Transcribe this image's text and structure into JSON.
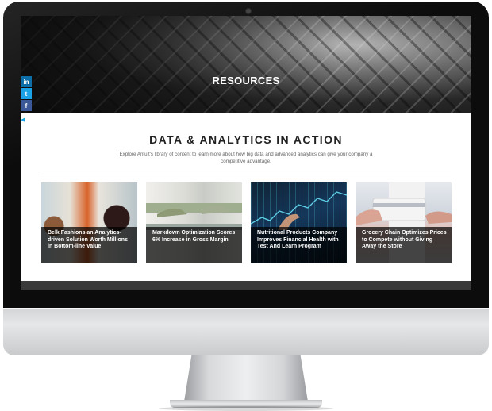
{
  "hero": {
    "title": "RESOURCES"
  },
  "social": [
    {
      "name": "linkedin-icon",
      "glyph": "in"
    },
    {
      "name": "twitter-icon",
      "glyph": "t"
    },
    {
      "name": "facebook-icon",
      "glyph": "f"
    }
  ],
  "section": {
    "title": "DATA & ANALYTICS IN ACTION",
    "description": "Explore Antuit's library of content to learn more about how big data and advanced analytics can give your company a competitive advantage."
  },
  "cards": [
    {
      "title": "Belk Fashions an Analytics-driven Solution Worth Millions in Bottom-line Value"
    },
    {
      "title": "Markdown Optimization Scores 6% Increase in Gross Margin"
    },
    {
      "title": "Nutritional Products Company Improves Financial Health with Test And Learn Program"
    },
    {
      "title": "Grocery Chain Optimizes Prices to Compete without Giving Away the Store"
    }
  ],
  "colors": {
    "linkedin": "#0e6fa8",
    "twitter": "#1ba1e6",
    "facebook": "#3b5998",
    "chart_line": "#5ed1e8"
  }
}
